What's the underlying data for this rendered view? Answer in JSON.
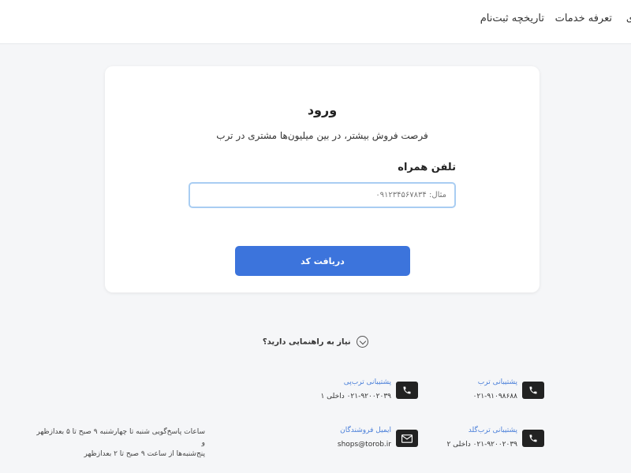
{
  "topnav": {
    "service_tariff": "تعرفه خدمات",
    "registration_history": "تاریخچه ثبت‌نام",
    "cut_item": "ی"
  },
  "login": {
    "title": "ورود",
    "subtitle": "فرصت فروش بیشتر، در بین میلیون‌ها مشتری در ترب",
    "phone_label": "تلفن همراه",
    "phone_placeholder": "مثال: ۰۹۱۲۳۴۵۶۷۸۳۴",
    "phone_value": "",
    "submit_label": "دریافت کد"
  },
  "help": {
    "text": "نیاز به راهنمایی دارید؟"
  },
  "contacts": [
    {
      "title": "پشتیبانی ترب",
      "value": "۰۲۱-۹۱۰۹۸۶۸۸",
      "icon": "phone-icon"
    },
    {
      "title": "پشتیبانی ترب‌پی",
      "value": "۰۲۱-۹۲۰۰۲۰۳۹ داخلی ۱",
      "icon": "phone-icon"
    },
    {
      "title": "پشتیبانی ترب‌گلد",
      "value": "۰۲۱-۹۲۰۰۲۰۳۹ داخلی ۲",
      "icon": "phone-icon"
    },
    {
      "title": "ایمیل فروشندگان",
      "value": "shops@torob.ir",
      "icon": "mail-icon"
    }
  ],
  "hours": {
    "line1": "ساعات پاسخ‌گویی شنبه تا چهارشنبه ۹ صبح تا ۵ بعدازظهر و",
    "line2": "پنج‌شنبه‌ها از ساعت ۹ صبح تا ۲ بعدازظهر"
  },
  "colors": {
    "primary": "#3c74dc",
    "link": "#4a7fd9",
    "background": "#f5f6f8"
  }
}
